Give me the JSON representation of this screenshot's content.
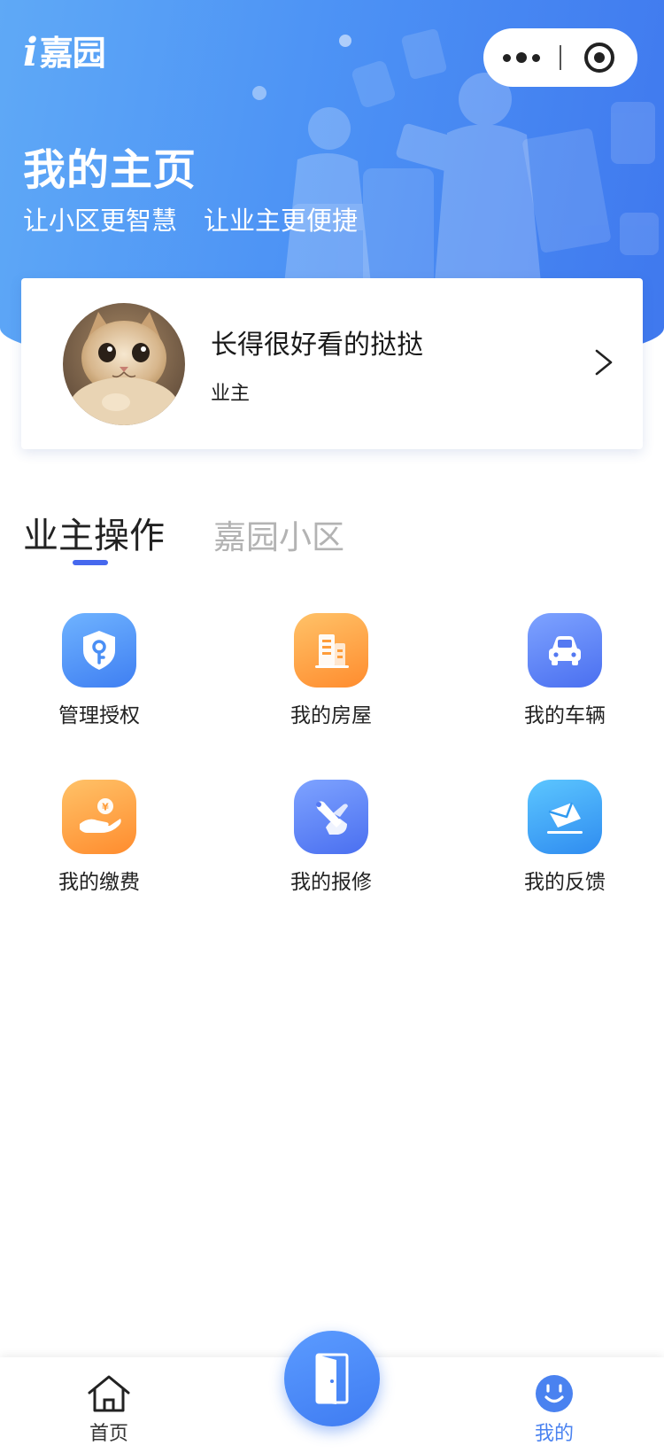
{
  "app": {
    "logo_i": "i",
    "logo_name": "嘉园"
  },
  "header": {
    "title": "我的主页",
    "slogan_1": "让小区更智慧",
    "slogan_2": "让业主更便捷"
  },
  "capsule": {
    "more_icon": "more-dots-icon",
    "close_icon": "target-circle-icon"
  },
  "profile": {
    "name": "长得很好看的挞挞",
    "role": "业主",
    "avatar_icon": "cat-avatar"
  },
  "tabs": [
    {
      "label": "业主操作",
      "active": true
    },
    {
      "label": "嘉园小区",
      "active": false
    }
  ],
  "menu": [
    {
      "label": "管理授权",
      "icon": "shield-key-icon",
      "color": "#4a8ff5"
    },
    {
      "label": "我的房屋",
      "icon": "building-icon",
      "color": "#ff9d3a"
    },
    {
      "label": "我的车辆",
      "icon": "car-icon",
      "color": "#5479f2"
    },
    {
      "label": "我的缴费",
      "icon": "hand-coin-icon",
      "color": "#ff9d3a"
    },
    {
      "label": "我的报修",
      "icon": "wrench-hand-icon",
      "color": "#5479f2"
    },
    {
      "label": "我的反馈",
      "icon": "envelope-icon",
      "color": "#2f9af0"
    }
  ],
  "tabbar": {
    "home_label": "首页",
    "center_icon": "door-icon",
    "mine_label": "我的",
    "active_color": "#4a82f0",
    "inactive_color": "#333333"
  }
}
